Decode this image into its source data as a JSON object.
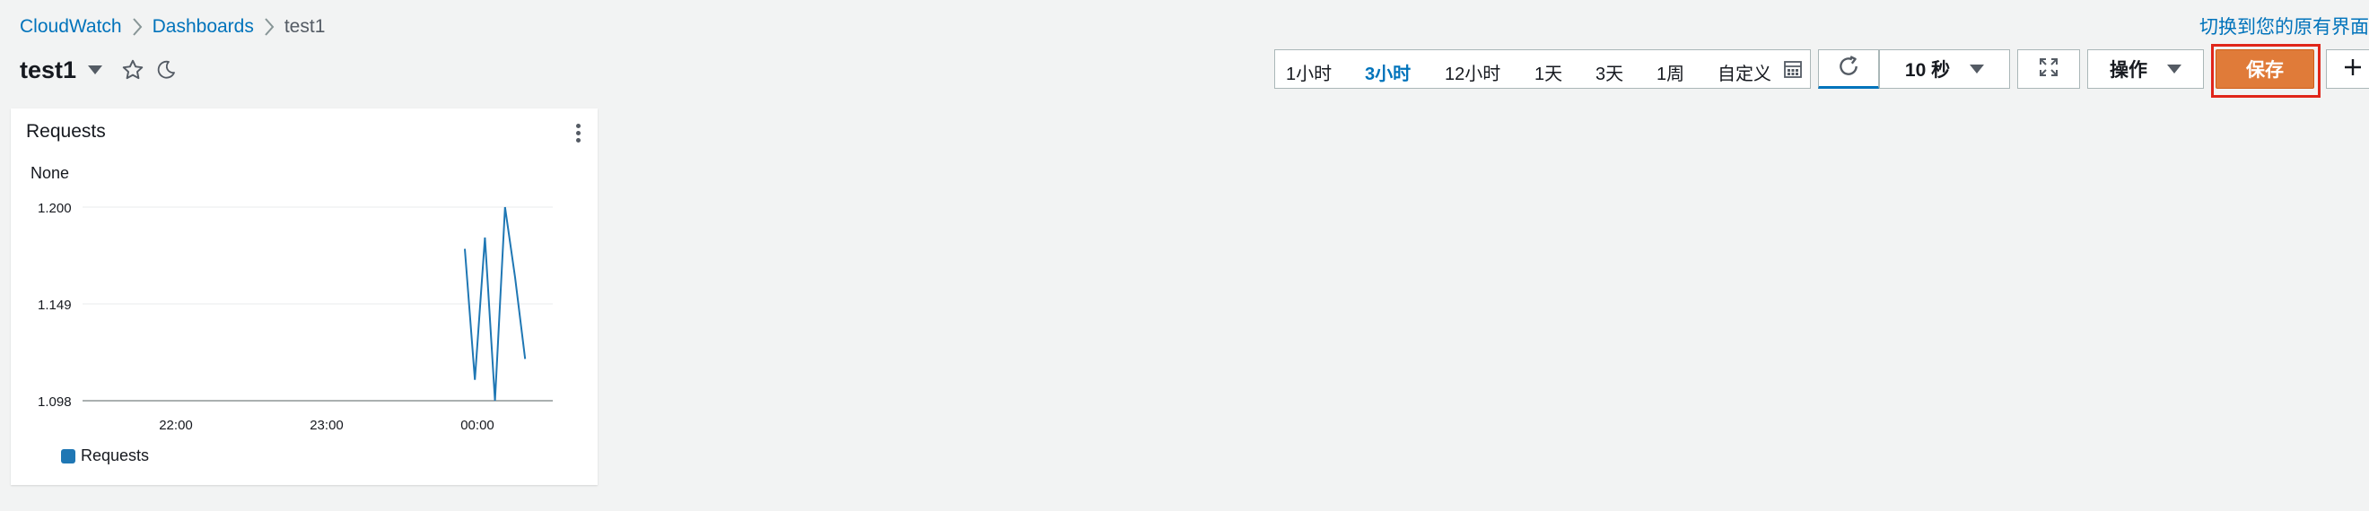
{
  "breadcrumb": {
    "items": [
      {
        "label": "CloudWatch"
      },
      {
        "label": "Dashboards"
      },
      {
        "label": "test1"
      }
    ]
  },
  "switch_link": "切换到您的原有界面",
  "title": "test1",
  "time_range": {
    "options": [
      "1小时",
      "3小时",
      "12小时",
      "1天",
      "3天",
      "1周",
      "自定义"
    ],
    "selected": "3小时"
  },
  "refresh": {
    "interval": "10 秒"
  },
  "actions_label": "操作",
  "save_label": "保存",
  "widget": {
    "title": "Requests",
    "unit": "None",
    "legend": "Requests",
    "series_color": "#1f77b4"
  },
  "chart_data": {
    "type": "line",
    "title": "Requests",
    "ylabel": "None",
    "ylim": [
      1.098,
      1.2
    ],
    "y_ticks": [
      "1.200",
      "1.149",
      "1.098"
    ],
    "x_ticks": [
      "22:00",
      "23:00",
      "00:00"
    ],
    "series": [
      {
        "name": "Requests",
        "points": [
          [
            "23:55",
            1.178
          ],
          [
            "23:59",
            1.109
          ],
          [
            "00:03",
            1.184
          ],
          [
            "00:07",
            1.098
          ],
          [
            "00:11",
            1.2
          ],
          [
            "00:15",
            1.163
          ],
          [
            "00:19",
            1.12
          ]
        ]
      }
    ]
  }
}
